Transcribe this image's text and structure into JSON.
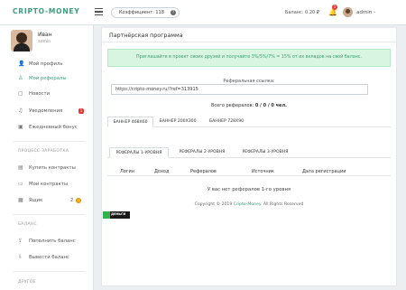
{
  "header": {
    "logo": "CRIPTO-MONEY",
    "coefficient": "Коэффициент: 118",
    "balance": "Баланс: 0.20 ₽",
    "notifications_count": "1",
    "user": "admin"
  },
  "sidebar": {
    "user_name": "Иван",
    "user_role": "admin",
    "items": [
      {
        "label": "Мой профиль",
        "icon": "person-icon"
      },
      {
        "label": "Мои рефералы",
        "icon": "users-icon"
      },
      {
        "label": "Новости",
        "icon": "document-icon"
      },
      {
        "label": "Уведомления",
        "icon": "bell-icon",
        "badge": "1"
      },
      {
        "label": "Ежедневный бонус",
        "icon": "gift-icon"
      }
    ],
    "section_earnings": "ПРОЦЕСС ЗАРАБОТКА",
    "earn_items": [
      {
        "label": "Купить контракты",
        "icon": "cart-icon"
      },
      {
        "label": "Мои контракты",
        "icon": "folder-icon"
      },
      {
        "label": "Ящик",
        "icon": "box-icon",
        "count": "2"
      }
    ],
    "section_balance": "БАЛАНС",
    "balance_items": [
      {
        "label": "Пополнить баланс",
        "icon": "deposit-icon"
      },
      {
        "label": "Вывести баланс",
        "icon": "withdraw-icon"
      }
    ],
    "section_other": "ДРУГОЕ"
  },
  "main": {
    "title": "Партнёрская программа",
    "alert": "Приглашайте в проект своих друзей и получайте 3%/5%/7% = 15% от их вкладов на свой баланс.",
    "ref_label": "Реферальная ссылка:",
    "ref_link": "https://cripto-money.ru/?ref=313915",
    "ref_total_label": "Всего рефералов:",
    "ref_total_value": "0 / 0 / 0 чел.",
    "banner_tabs": [
      "БАННЕР 468X60",
      "БАННЕР 200X300",
      "БАННЕР 728X90"
    ],
    "level_tabs": [
      "РЕФЕРАЛЫ 1-УРОВНЯ",
      "РЕФЕРАЛЫ 2-УРОВНЯ",
      "РЕФЕРАЛЫ 3-УРОВНЯ"
    ],
    "table_headers": [
      "Логин",
      "Доход",
      "Рефералов",
      "Источник",
      "Дата регистрации"
    ],
    "empty_message": "У вас нет рефералов 1-го уровня",
    "copyright_prefix": "Copyright © 2019",
    "copyright_brand": "Cripto-Money",
    "copyright_suffix": ". All Rights Reserved",
    "counter_label": "ДЕНЬГИ"
  },
  "colors": {
    "accent": "#3a9e7d",
    "alert_bg": "#d8f5e2",
    "badge": "#e53935"
  }
}
